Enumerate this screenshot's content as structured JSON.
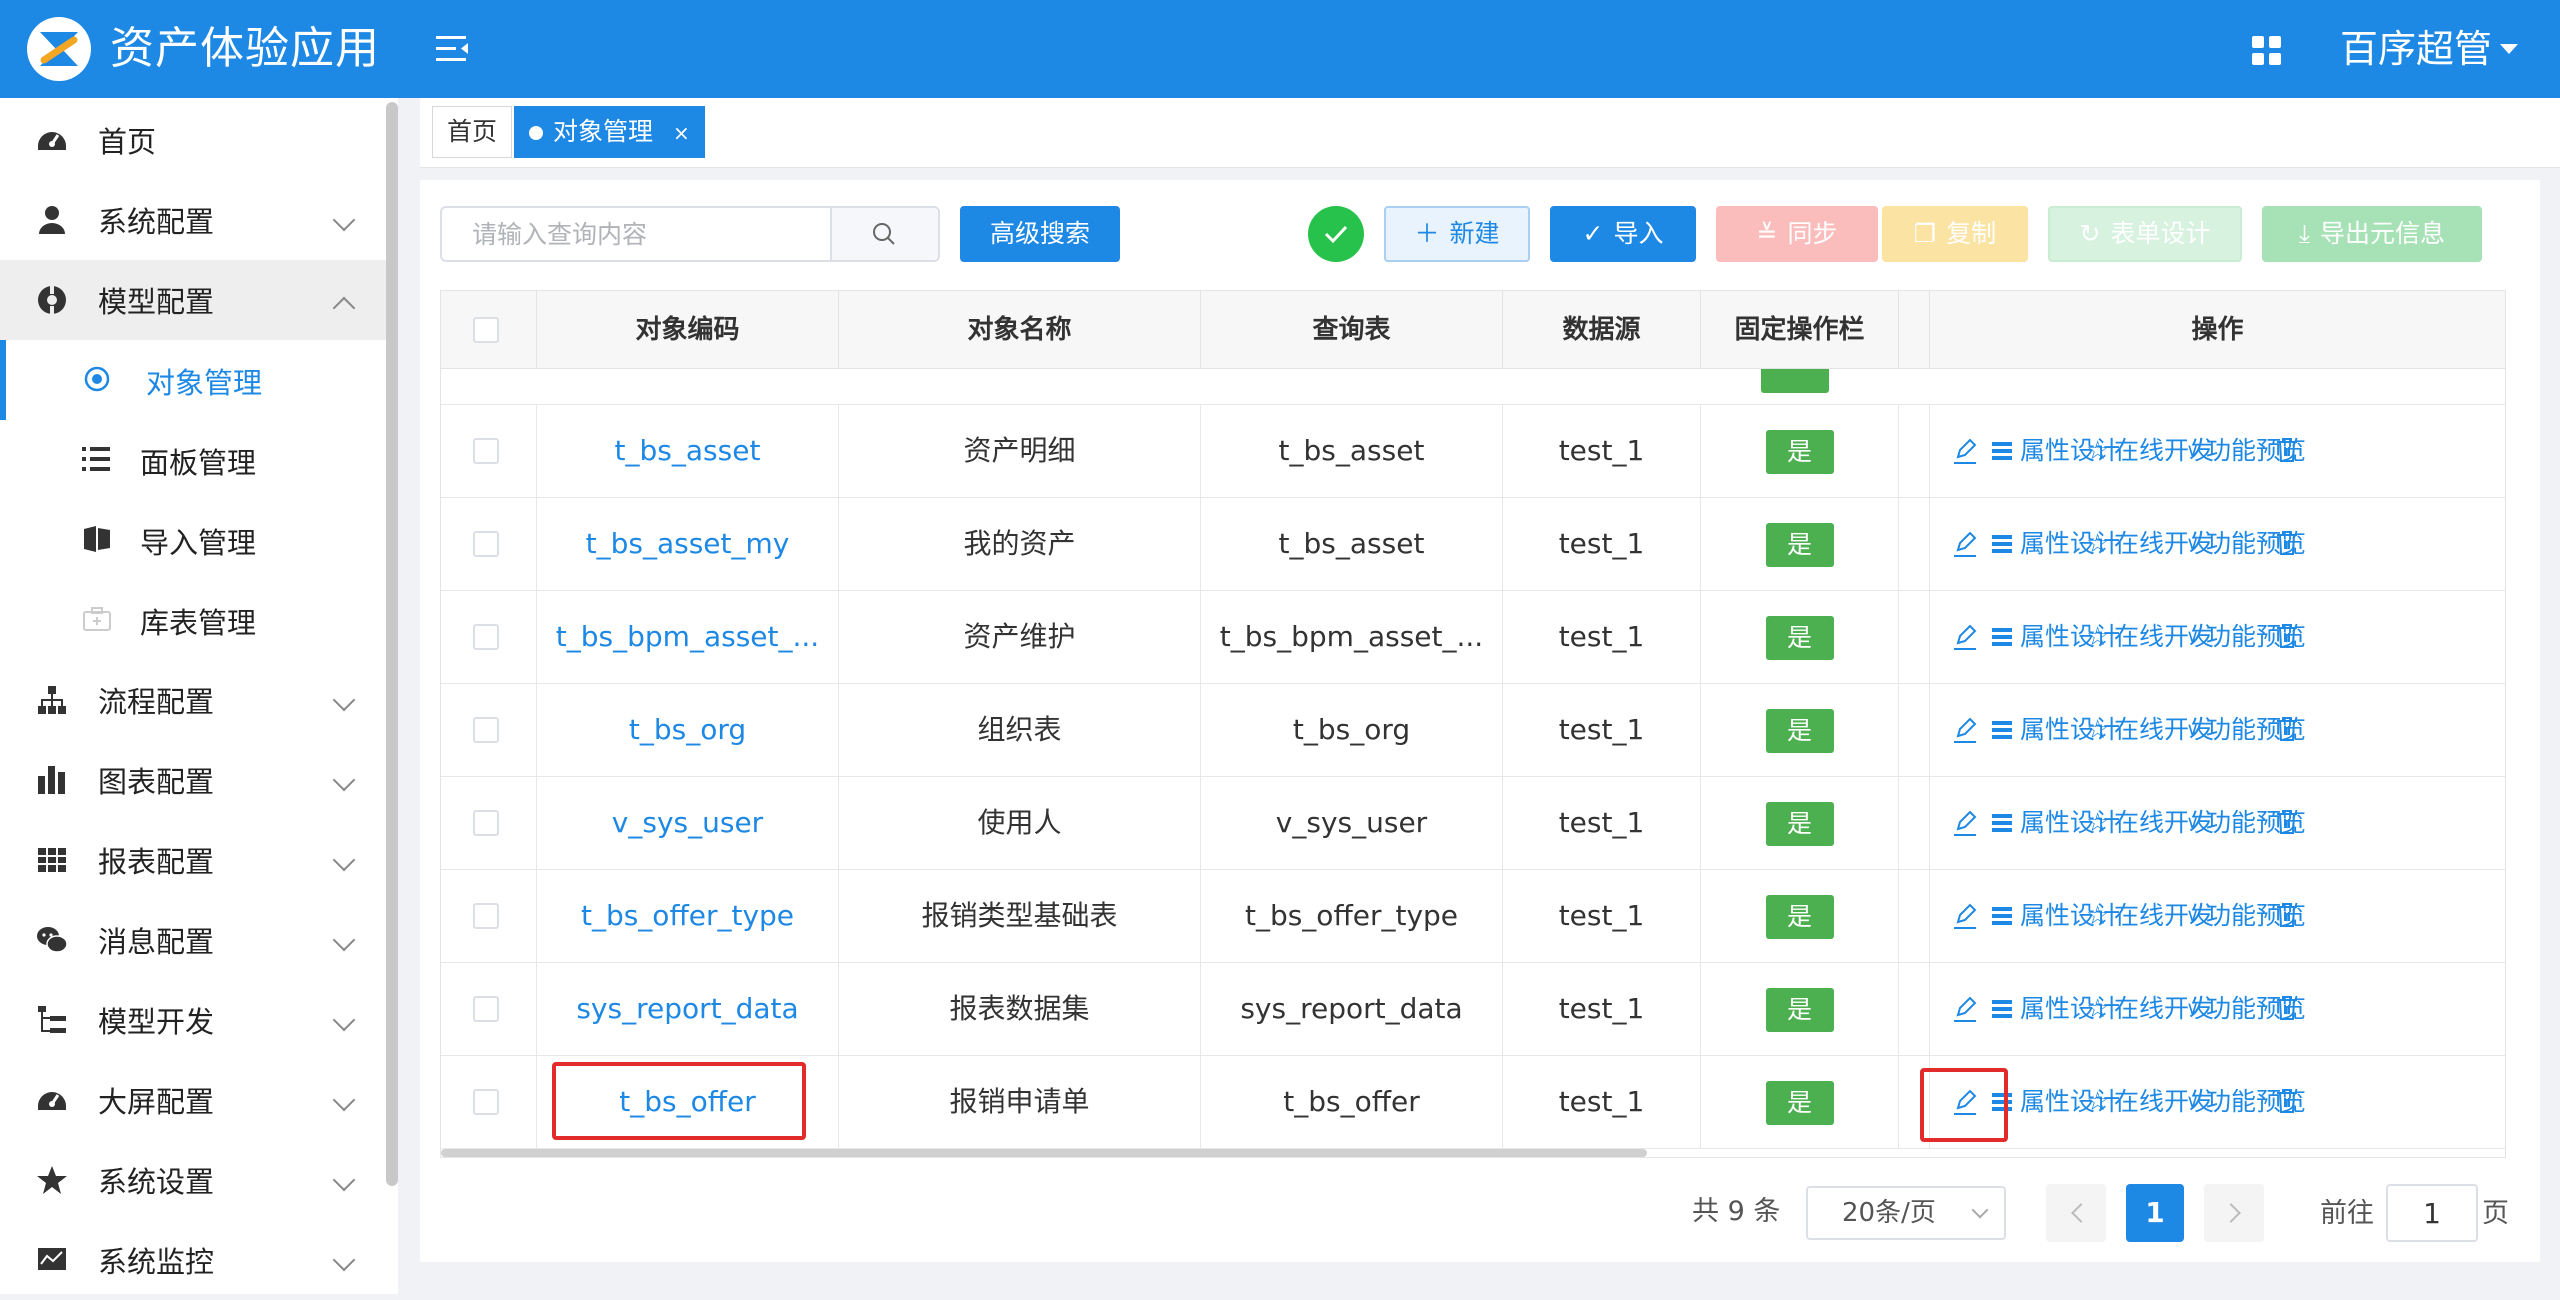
{
  "header": {
    "app_title": "资产体验应用",
    "user_name": "百序超管",
    "brand_color": "#1e88e5"
  },
  "sidebar": {
    "items": [
      {
        "label": "首页",
        "icon": "dashboard-icon"
      },
      {
        "label": "系统配置",
        "icon": "user-icon"
      },
      {
        "label": "模型配置",
        "icon": "model-icon"
      },
      {
        "label": "对象管理",
        "icon": "radio-dot-icon"
      },
      {
        "label": "面板管理",
        "icon": "list-icon"
      },
      {
        "label": "导入管理",
        "icon": "import-icon"
      },
      {
        "label": "库表管理",
        "icon": "database-icon"
      },
      {
        "label": "流程配置",
        "icon": "flow-icon"
      },
      {
        "label": "图表配置",
        "icon": "bar-chart-icon"
      },
      {
        "label": "报表配置",
        "icon": "grid-icon"
      },
      {
        "label": "消息配置",
        "icon": "wechat-icon"
      },
      {
        "label": "模型开发",
        "icon": "tree-icon"
      },
      {
        "label": "大屏配置",
        "icon": "dashboard-icon"
      },
      {
        "label": "系统设置",
        "icon": "star-icon"
      },
      {
        "label": "系统监控",
        "icon": "monitor-icon"
      }
    ]
  },
  "tabs": [
    {
      "label": "首页"
    },
    {
      "label": "对象管理"
    }
  ],
  "toolbar": {
    "search_placeholder": "请输入查询内容",
    "advanced_search": "高级搜索",
    "new": "新建",
    "import": "导入",
    "sync": "同步",
    "copy": "复制",
    "form_design": "表单设计",
    "export_meta": "导出元信息"
  },
  "table": {
    "headers": [
      "对象编码",
      "对象名称",
      "查询表",
      "数据源",
      "固定操作栏",
      "操作"
    ],
    "ops": {
      "attr_design": "属性设计",
      "online_dev": "在线开发",
      "preview": "功能预览"
    },
    "rows": [
      {
        "code": "t_bs_asset",
        "name": "资产明细",
        "table": "t_bs_asset",
        "source": "test_1",
        "fixed": "是"
      },
      {
        "code": "t_bs_asset_my",
        "name": "我的资产",
        "table": "t_bs_asset",
        "source": "test_1",
        "fixed": "是"
      },
      {
        "code": "t_bs_bpm_asset_...",
        "name": "资产维护",
        "table": "t_bs_bpm_asset_...",
        "source": "test_1",
        "fixed": "是"
      },
      {
        "code": "t_bs_org",
        "name": "组织表",
        "table": "t_bs_org",
        "source": "test_1",
        "fixed": "是"
      },
      {
        "code": "v_sys_user",
        "name": "使用人",
        "table": "v_sys_user",
        "source": "test_1",
        "fixed": "是"
      },
      {
        "code": "t_bs_offer_type",
        "name": "报销类型基础表",
        "table": "t_bs_offer_type",
        "source": "test_1",
        "fixed": "是"
      },
      {
        "code": "sys_report_data",
        "name": "报表数据集",
        "table": "sys_report_data",
        "source": "test_1",
        "fixed": "是"
      },
      {
        "code": "t_bs_offer",
        "name": "报销申请单",
        "table": "t_bs_offer",
        "source": "test_1",
        "fixed": "是"
      }
    ]
  },
  "pagination": {
    "total": "共 9 条",
    "page_size": "20条/页",
    "current": "1",
    "goto_label": "前往",
    "goto_value": "1",
    "page_unit": "页"
  }
}
